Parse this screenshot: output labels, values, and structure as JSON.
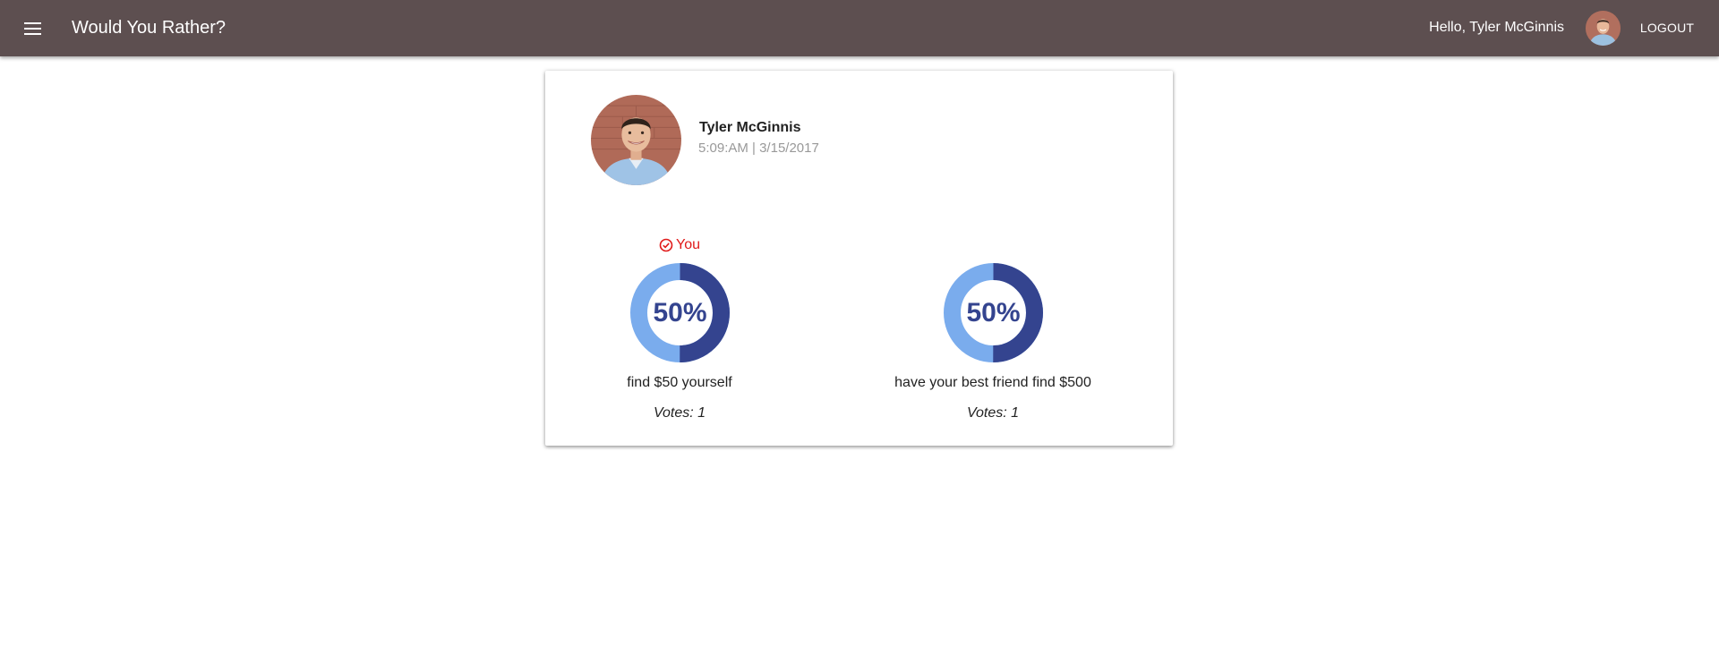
{
  "header": {
    "title": "Would You Rather?",
    "greeting": "Hello, Tyler McGinnis",
    "logout_label": "LOGOUT",
    "bar_color": "#5d4f50",
    "menu_icon": "hamburger-menu-icon"
  },
  "question": {
    "author_name": "Tyler McGinnis",
    "timestamp": "5:09:AM | 3/15/2017",
    "you_label": "You",
    "you_icon": "check-circle-icon",
    "options": [
      {
        "text": "find $50 yourself",
        "percent_label": "50%",
        "percent": 50,
        "votes_label": "Votes: 1",
        "selected_by_user": true
      },
      {
        "text": "have your best friend find $500",
        "percent_label": "50%",
        "percent": 50,
        "votes_label": "Votes: 1",
        "selected_by_user": false
      }
    ]
  },
  "colors": {
    "donut_primary": "#34448f",
    "donut_secondary": "#7aaced",
    "you_badge": "#e01919"
  }
}
